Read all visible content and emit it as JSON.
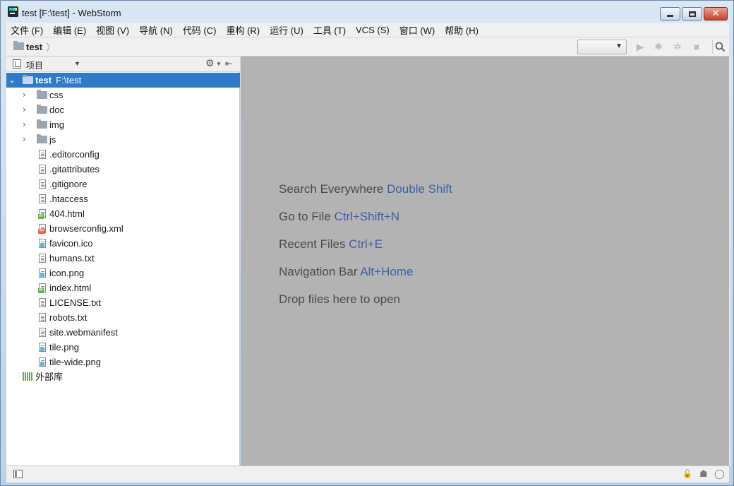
{
  "window": {
    "title": "test [F:\\test] - WebStorm"
  },
  "menu": [
    {
      "label": "文件 (F)",
      "name": "menu-file"
    },
    {
      "label": "编辑 (E)",
      "name": "menu-edit"
    },
    {
      "label": "视图 (V)",
      "name": "menu-view"
    },
    {
      "label": "导航 (N)",
      "name": "menu-navigate"
    },
    {
      "label": "代码 (C)",
      "name": "menu-code"
    },
    {
      "label": "重构 (R)",
      "name": "menu-refactor"
    },
    {
      "label": "运行 (U)",
      "name": "menu-run"
    },
    {
      "label": "工具 (T)",
      "name": "menu-tools"
    },
    {
      "label": "VCS (S)",
      "name": "menu-vcs"
    },
    {
      "label": "窗口 (W)",
      "name": "menu-window"
    },
    {
      "label": "帮助 (H)",
      "name": "menu-help"
    }
  ],
  "navbar": {
    "breadcrumb": "test",
    "run_config_value": ""
  },
  "project_panel": {
    "title": "项目",
    "root": {
      "name": "test",
      "path": "F:\\test"
    },
    "folders": [
      "css",
      "doc",
      "img",
      "js"
    ],
    "files": [
      {
        "name": ".editorconfig",
        "type": "text"
      },
      {
        "name": ".gitattributes",
        "type": "text"
      },
      {
        "name": ".gitignore",
        "type": "text"
      },
      {
        "name": ".htaccess",
        "type": "text"
      },
      {
        "name": "404.html",
        "type": "html"
      },
      {
        "name": "browserconfig.xml",
        "type": "xml"
      },
      {
        "name": "favicon.ico",
        "type": "img"
      },
      {
        "name": "humans.txt",
        "type": "text"
      },
      {
        "name": "icon.png",
        "type": "img"
      },
      {
        "name": "index.html",
        "type": "html"
      },
      {
        "name": "LICENSE.txt",
        "type": "text"
      },
      {
        "name": "robots.txt",
        "type": "text"
      },
      {
        "name": "site.webmanifest",
        "type": "text"
      },
      {
        "name": "tile.png",
        "type": "img"
      },
      {
        "name": "tile-wide.png",
        "type": "img"
      }
    ],
    "external_libraries": "外部库"
  },
  "editor_hints": [
    {
      "text": "Search Everywhere",
      "key": "Double Shift"
    },
    {
      "text": "Go to File",
      "key": "Ctrl+Shift+N"
    },
    {
      "text": "Recent Files",
      "key": "Ctrl+E"
    },
    {
      "text": "Navigation Bar",
      "key": "Alt+Home"
    },
    {
      "text": "Drop files here to open",
      "key": ""
    }
  ],
  "colors": {
    "selection": "#2e7bc8",
    "editor_bg": "#b3b3b3",
    "shortcut": "#3d5fa8"
  }
}
